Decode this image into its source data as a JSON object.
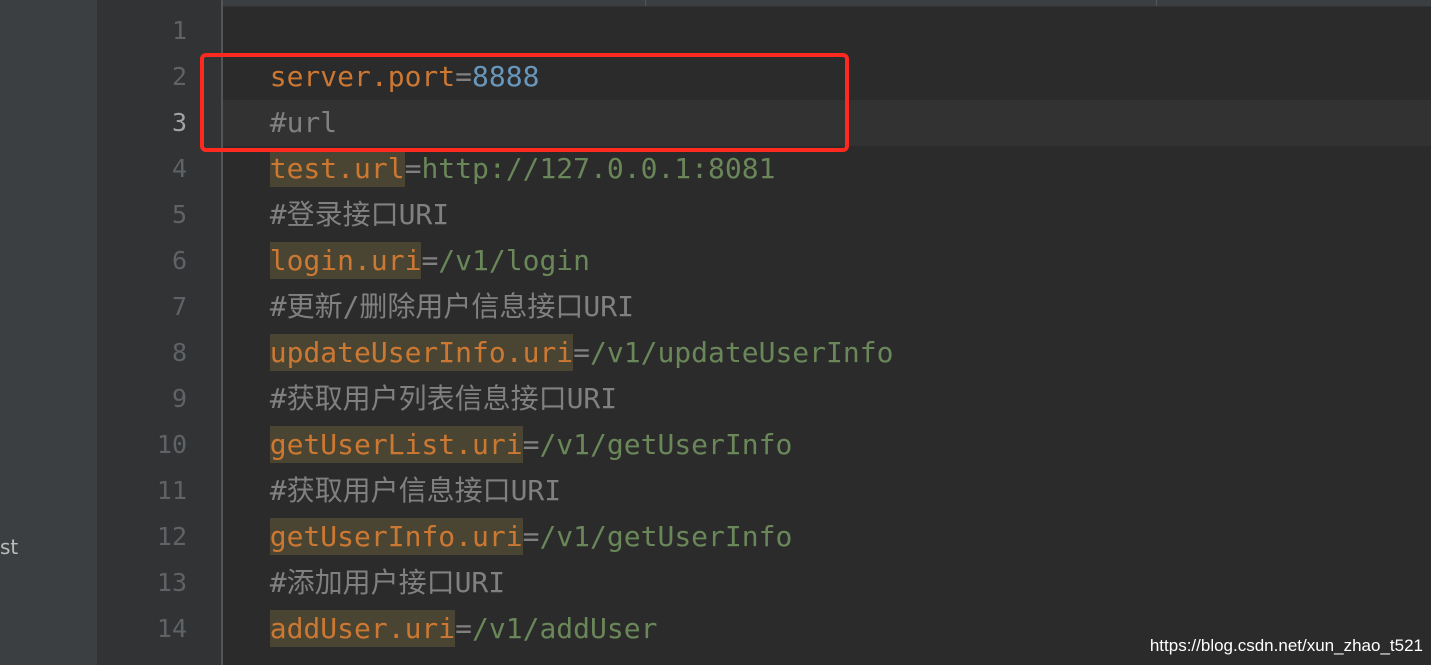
{
  "side_panel": {
    "partial_label": "st"
  },
  "editor": {
    "lines": [
      {
        "no": "1",
        "key": "server.port",
        "sep": "=",
        "value": "8888"
      },
      {
        "no": "2",
        "comment": "#url"
      },
      {
        "no": "3",
        "key": "test.url",
        "sep": "=",
        "value": "http://127.0.0.1:8081"
      },
      {
        "no": "4",
        "comment": "#登录接口URI"
      },
      {
        "no": "5",
        "key": "login.uri",
        "sep": "=",
        "value": "/v1/login"
      },
      {
        "no": "6",
        "comment": "#更新/删除用户信息接口URI"
      },
      {
        "no": "7",
        "key": "updateUserInfo.uri",
        "sep": "=",
        "value": "/v1/updateUserInfo"
      },
      {
        "no": "8",
        "comment": "#获取用户列表信息接口URI"
      },
      {
        "no": "9",
        "key": "getUserList.uri",
        "sep": "=",
        "value": "/v1/getUserInfo"
      },
      {
        "no": "10",
        "comment": "#获取用户信息接口URI"
      },
      {
        "no": "11",
        "key": "getUserInfo.uri",
        "sep": "=",
        "value": "/v1/getUserInfo"
      },
      {
        "no": "12",
        "comment": "#添加用户接口URI"
      },
      {
        "no": "13",
        "key": "addUser.uri",
        "sep": "=",
        "value": "/v1/addUser"
      },
      {
        "no": "14"
      }
    ],
    "current_line": "3"
  },
  "colors": {
    "background": "#2b2b2b",
    "key": "#cc7832",
    "value": "#6a8759",
    "number": "#6897bb",
    "comment": "#808080",
    "annotation_box": "#ff2a1f"
  },
  "watermark": "https://blog.csdn.net/xun_zhao_t521"
}
